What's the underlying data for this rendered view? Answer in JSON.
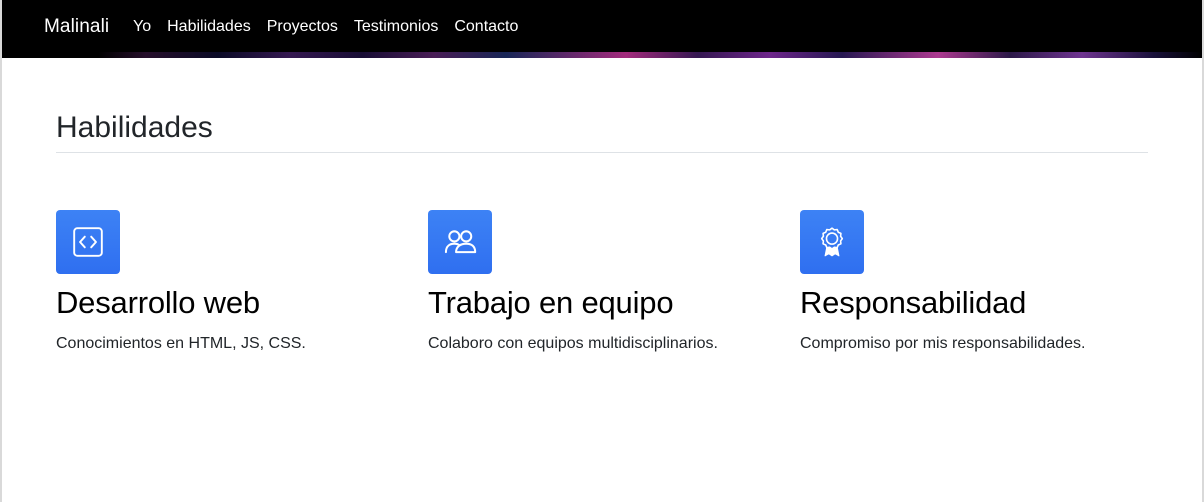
{
  "navbar": {
    "brand": "Malinali",
    "links": [
      "Yo",
      "Habilidades",
      "Proyectos",
      "Testimonios",
      "Contacto"
    ]
  },
  "section": {
    "title": "Habilidades"
  },
  "features": [
    {
      "icon": "code-icon",
      "title": "Desarrollo web",
      "description": "Conocimientos en HTML, JS, CSS."
    },
    {
      "icon": "people-icon",
      "title": "Trabajo en equipo",
      "description": "Colaboro con equipos multidisciplinarios."
    },
    {
      "icon": "award-icon",
      "title": "Responsabilidad",
      "description": "Compromiso por mis responsabilidades."
    }
  ],
  "colors": {
    "navbar_bg": "#000000",
    "icon_bg": "#3478f6",
    "text": "#212529",
    "rule": "#dee2e6"
  }
}
